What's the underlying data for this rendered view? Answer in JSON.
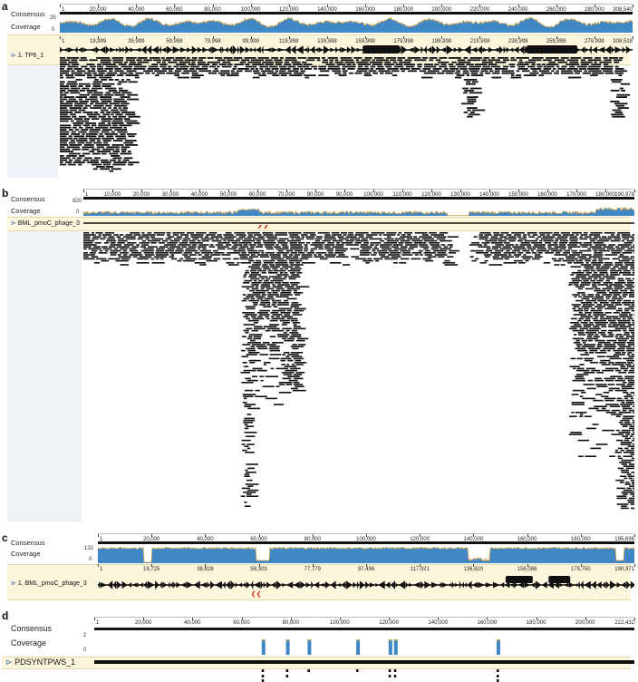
{
  "panels": {
    "a": {
      "letter": "a",
      "consensus": "Consensus",
      "coverage": "Coverage",
      "ymax": "25",
      "ymin": "0",
      "ruler_ticks": [
        "1",
        "20,000",
        "40,000",
        "60,000",
        "80,000",
        "100,000",
        "120,000",
        "140,000",
        "160,000",
        "180,000",
        "200,000",
        "220,000",
        "240,000",
        "260,000",
        "280,000",
        "308,540"
      ],
      "ref_ticks": [
        "1",
        "19,999",
        "39,999",
        "59,998",
        "79,998",
        "99,998",
        "119,998",
        "139,998",
        "159,998",
        "179,998",
        "199,998",
        "219,998",
        "239,998",
        "259,998",
        "279,998",
        "308,518"
      ],
      "track_label": "1. TP6_1"
    },
    "b": {
      "letter": "b",
      "consensus": "Consensus",
      "coverage": "Coverage",
      "ymax": "820",
      "ymin": "0",
      "ruler_ticks": [
        "1",
        "10,000",
        "20,000",
        "30,000",
        "40,000",
        "50,000",
        "60,000",
        "70,000",
        "80,000",
        "90,000",
        "100,000",
        "110,000",
        "120,000",
        "130,000",
        "140,000",
        "150,000",
        "160,000",
        "170,000",
        "180,000",
        "190,978"
      ],
      "track_label": "BML_pmoC_phage_3"
    },
    "c": {
      "letter": "c",
      "consensus": "Consensus",
      "coverage": "Coverage",
      "ymax": "132",
      "ymin": "0",
      "ruler_ticks": [
        "1",
        "20,000",
        "40,000",
        "60,000",
        "80,000",
        "100,000",
        "120,000",
        "140,000",
        "160,000",
        "180,000",
        "195,636"
      ],
      "ref_ticks": [
        "1",
        "19,725",
        "38,828",
        "58,303",
        "77,779",
        "97,496",
        "117,021",
        "136,620",
        "156,086",
        "175,750",
        "190,971"
      ],
      "track_label": "1. BML_pmoC_phage_3"
    },
    "d": {
      "letter": "d",
      "consensus": "Consensus",
      "coverage": "Coverage",
      "ymax": "2",
      "ymin": "0",
      "ruler_ticks": [
        "1",
        "20,000",
        "40,000",
        "60,000",
        "80,000",
        "100,000",
        "120,000",
        "140,000",
        "160,000",
        "180,000",
        "200,000",
        "222,432"
      ],
      "track_label": "PDSYNTPWS_1"
    }
  },
  "colors": {
    "coverage_fill": "#3f88c5",
    "coverage_top": "#d2a24a",
    "track_bg": "#fbf6dc",
    "side_bg": "#eef1f6",
    "marker": "#d9261c",
    "ink": "#111111"
  }
}
